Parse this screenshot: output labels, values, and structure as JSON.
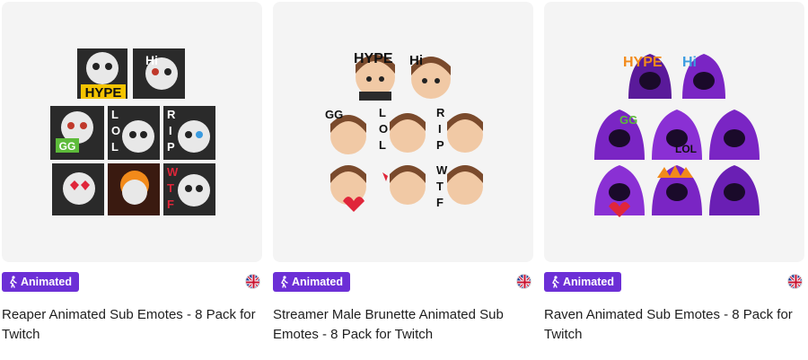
{
  "products": [
    {
      "badge": "Animated",
      "title": "Reaper Animated Sub Emotes - 8 Pack for Twitch",
      "thumb_labels": [
        "HYPE",
        "Hi",
        "L",
        "O",
        "L",
        "R",
        "I",
        "P",
        "W",
        "T",
        "F",
        "GG"
      ]
    },
    {
      "badge": "Animated",
      "title": "Streamer Male Brunette Animated Sub Emotes - 8 Pack for Twitch",
      "thumb_labels": [
        "HYPE",
        "Hi",
        "GG",
        "L",
        "O",
        "L",
        "R",
        "I",
        "P",
        "W",
        "T",
        "F"
      ]
    },
    {
      "badge": "Animated",
      "title": "Raven Animated Sub Emotes - 8 Pack for Twitch",
      "thumb_labels": [
        "HYPE",
        "Hi",
        "GG",
        "LOL"
      ]
    }
  ],
  "colors": {
    "badge_bg": "#6c2fd6",
    "thumb_bg": "#f4f4f4",
    "reaper_hood": "#222222",
    "streamer_hair": "#7a4a2c",
    "raven_hood": "#7a25c4"
  },
  "icons": [
    "walking-person-icon",
    "uk-flag-icon"
  ]
}
